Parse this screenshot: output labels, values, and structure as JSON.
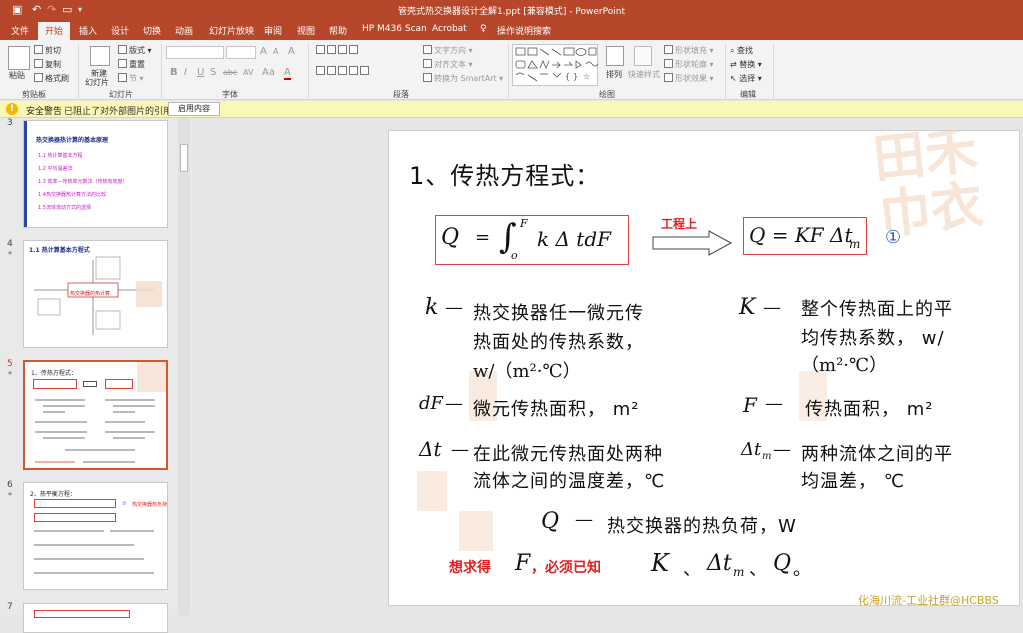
{
  "window": {
    "title": "管壳式热交换器设计全解1.ppt [兼容模式] - PowerPoint",
    "quick_access": [
      "save-icon",
      "undo-icon",
      "redo-icon",
      "start-from-beginning-icon",
      "customize-icon"
    ]
  },
  "tabs": [
    "文件",
    "开始",
    "插入",
    "设计",
    "切换",
    "动画",
    "幻灯片放映",
    "审阅",
    "视图",
    "帮助",
    "HP M436 Scan",
    "Acrobat",
    "操作说明搜索"
  ],
  "active_tab": "开始",
  "ribbon": {
    "clipboard": {
      "paste": "粘贴",
      "cut": "剪切",
      "copy": "复制",
      "format_painter": "格式刷",
      "label": "剪贴板"
    },
    "slides": {
      "new_slide": "新建",
      "new_slide2": "幻灯片",
      "layout": "版式",
      "reset": "重置",
      "section": "节",
      "label": "幻灯片"
    },
    "font": {
      "font_name": "",
      "font_size": "",
      "bold": "B",
      "italic": "I",
      "underline": "U",
      "shadow": "S",
      "strike": "abc",
      "spacing": "AV",
      "case": "Aa",
      "color": "A",
      "grow": "A",
      "shrink": "A",
      "clear": "A",
      "label": "字体"
    },
    "paragraph": {
      "text_direction": "文字方向",
      "align_text": "对齐文本",
      "convert_smartart": "转换为 SmartArt",
      "label": "段落"
    },
    "drawing": {
      "arrange": "排列",
      "quick_styles": "快速样式",
      "shape_fill": "形状填充",
      "shape_outline": "形状轮廓",
      "shape_effects": "形状效果",
      "label": "绘图"
    },
    "editing": {
      "find": "查找",
      "replace": "替换",
      "select": "选择",
      "label": "编辑"
    }
  },
  "security_bar": {
    "title": "安全警告",
    "message": "已阻止了对外部图片的引用",
    "button": "启用内容"
  },
  "thumbnails": [
    {
      "num": "3",
      "title": "热交换器热计算的基本原理",
      "items": [
        "1.1 热计算基本方程",
        "1.2 平均温差法",
        "1.3 效率—传热单元数法（传热有效度）",
        "1.4热交换器热计算方法的比较",
        "1.5流体流动方式的选择"
      ]
    },
    {
      "num": "4",
      "star": "*",
      "title": "1.1  热计算基本方程式",
      "center_label": "热交换器的热计算"
    },
    {
      "num": "5",
      "star": "*",
      "title": "1、传热方程式：",
      "selected": true
    },
    {
      "num": "6",
      "star": "*",
      "title": "2、热平衡方程：",
      "note": "热交换器热负荷"
    },
    {
      "num": "7"
    }
  ],
  "slide": {
    "heading": "1、传热方程式：",
    "eq1_Q": "Q",
    "eq1_eq": "=",
    "eq1_sup": "F",
    "eq1_sub": "o",
    "eq1_body": "k Δ tdF",
    "engineering": "工程上",
    "eq2": "Q = KF Δt",
    "eq2_sub": "m",
    "circle_num": "①",
    "k_sym": "k",
    "k_dash": "—",
    "k_desc1": "热交换器任一微元传",
    "k_desc2": "热面处的传热系数，",
    "k_unit": "w/（m²·℃）",
    "K_sym": "K",
    "K_dash": "—",
    "K_desc1": "整个传热面上的平",
    "K_desc2": "均传热系数，  w/",
    "K_unit": "（m²·℃）",
    "dF_sym": "dF",
    "dF_desc": "微元传热面积，  m²",
    "F_sym": "F",
    "F_dash": "—",
    "F_desc": "传热面积，  m²",
    "dt_sym": "Δt",
    "dt_desc1": "在此微元传热面处两种",
    "dt_desc2": "流体之间的温度差，℃",
    "dtm_sym": "Δt",
    "dtm_sub": "m",
    "dtm_desc1": "两种流体之间的平",
    "dtm_desc2": "均温差，  ℃",
    "Q_sym": "Q",
    "Q_dash": "—",
    "Q_desc": "热交换器的热负荷，W",
    "bottom_red": "想求得",
    "bottom_F": "F",
    "bottom_red2": "，必须已知",
    "bottom_K": "K",
    "bottom_sep1": "、",
    "bottom_dt": "Δt",
    "bottom_dt_sub": "m",
    "bottom_sep2": "、",
    "bottom_Q": "Q",
    "bottom_end": "。"
  },
  "watermark": "化海川流-工业社群@HCBBS"
}
